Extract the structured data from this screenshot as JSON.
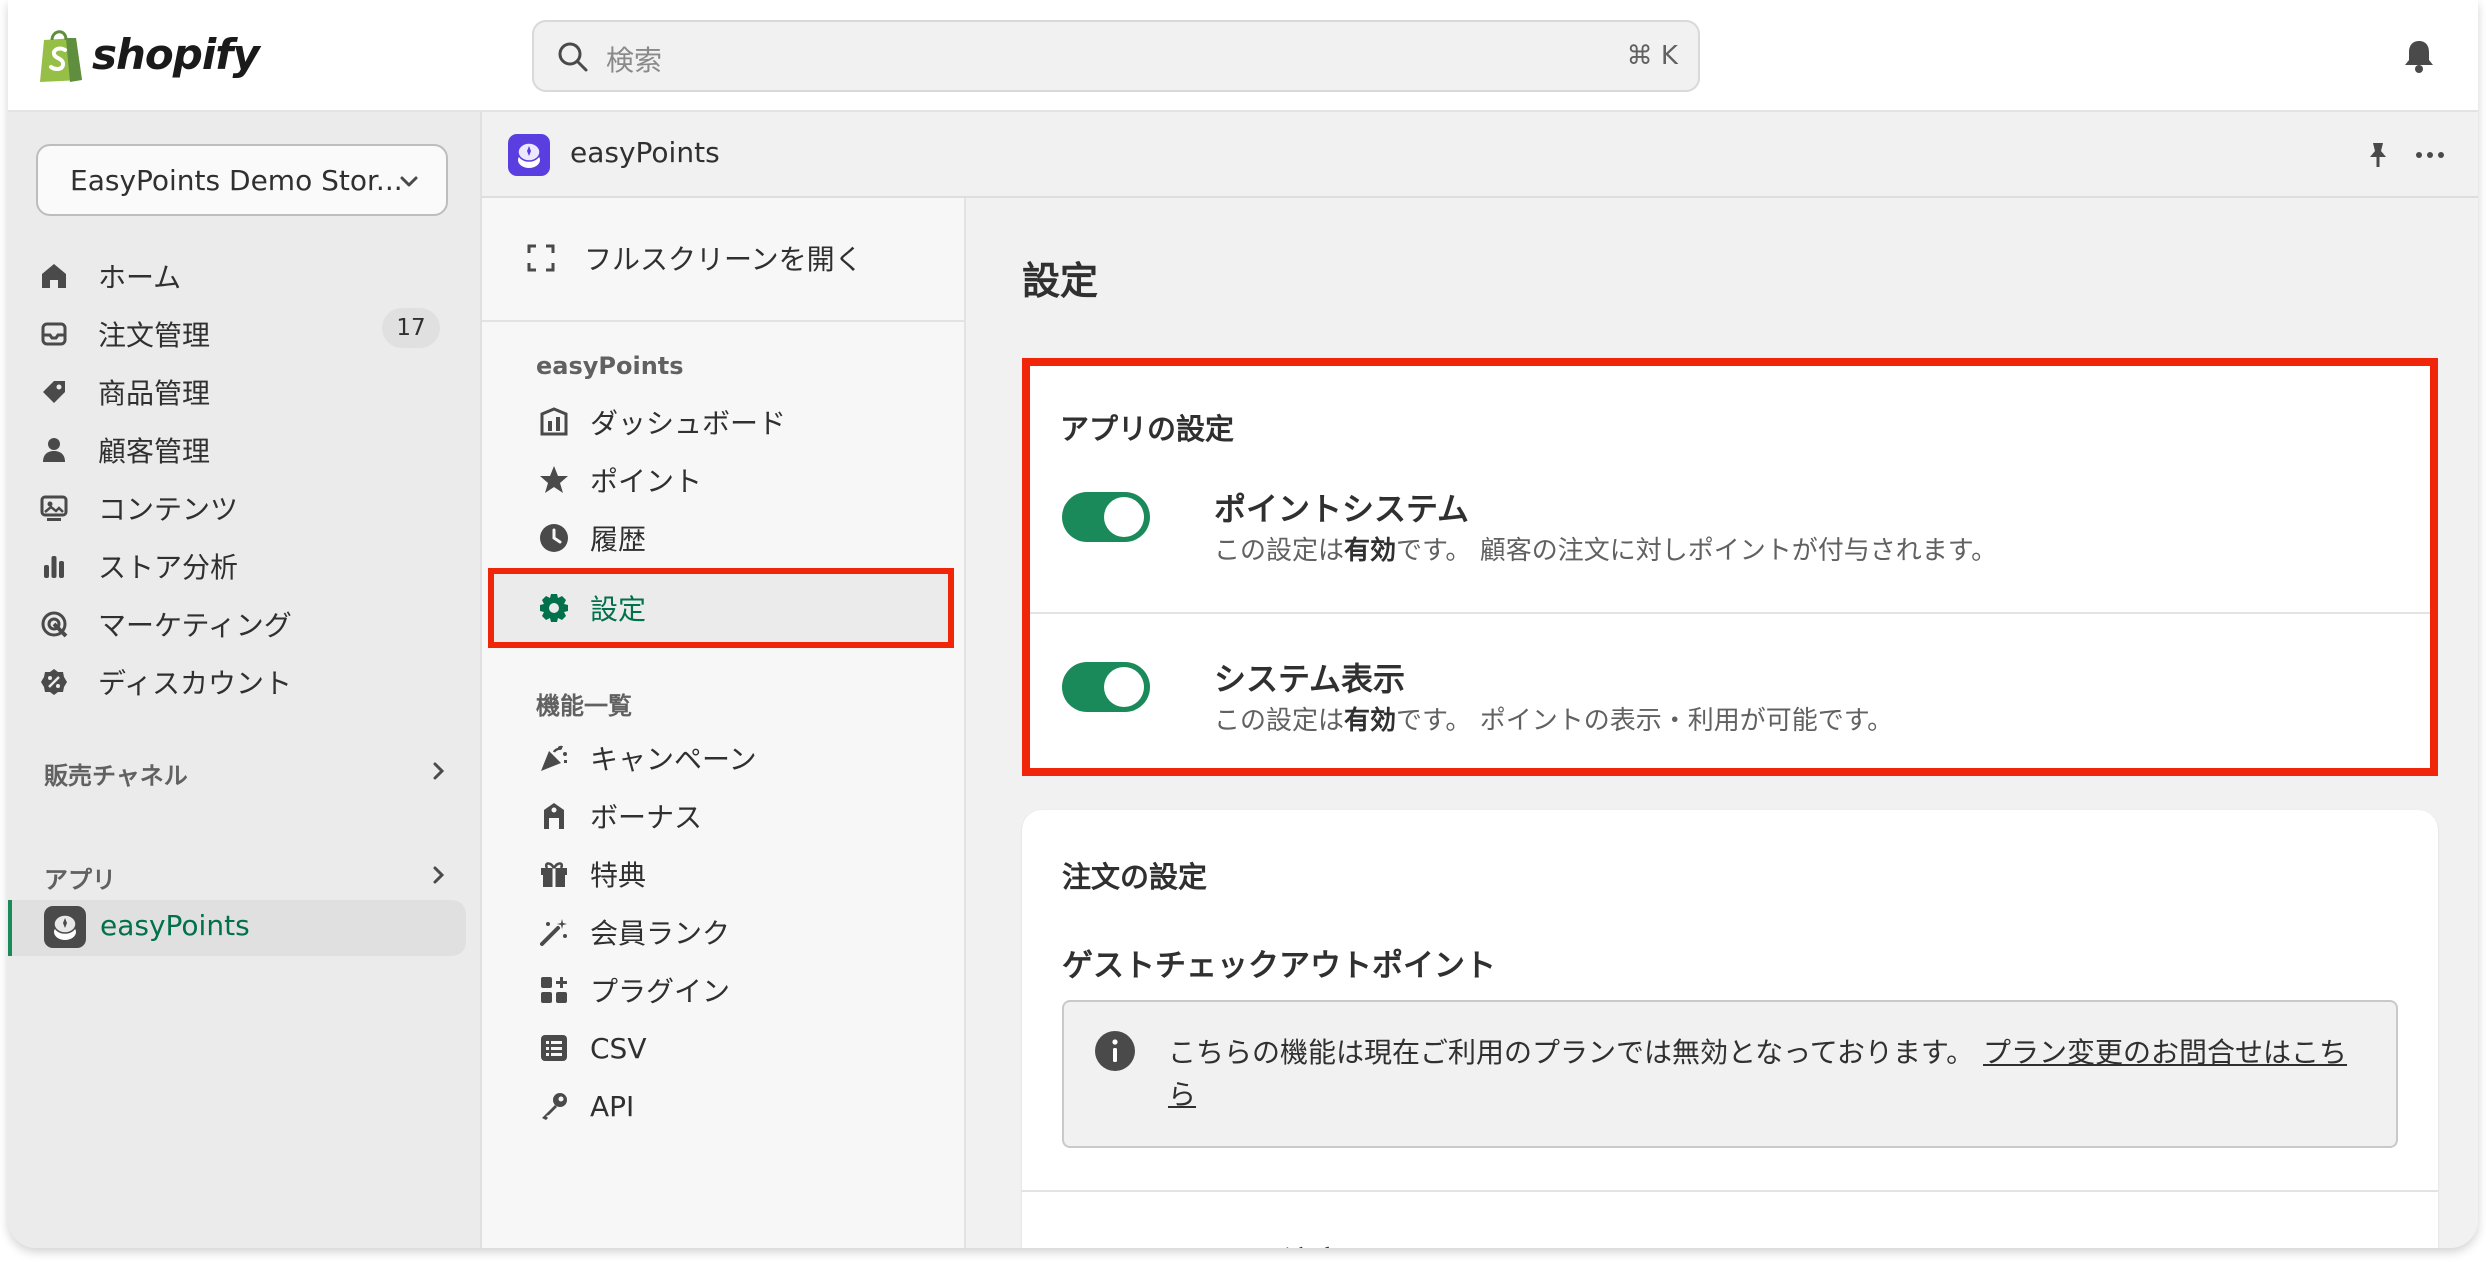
{
  "topbar": {
    "logo_text": "shopify",
    "search_placeholder": "検索",
    "search_shortcut": "⌘ K",
    "icons": [
      "search-icon",
      "bell-icon"
    ]
  },
  "sidebar": {
    "store_name": "EasyPoints Demo Stor...",
    "items": [
      {
        "label": "ホーム",
        "icon": "home-icon"
      },
      {
        "label": "注文管理",
        "icon": "inbox-icon",
        "badge": "17"
      },
      {
        "label": "商品管理",
        "icon": "tag-icon"
      },
      {
        "label": "顧客管理",
        "icon": "person-icon"
      },
      {
        "label": "コンテンツ",
        "icon": "content-icon"
      },
      {
        "label": "ストア分析",
        "icon": "bar-chart-icon"
      },
      {
        "label": "マーケティング",
        "icon": "target-icon"
      },
      {
        "label": "ディスカウント",
        "icon": "discount-icon"
      }
    ],
    "sales_channels_label": "販売チャネル",
    "apps_label": "アプリ",
    "active_app": "easyPoints"
  },
  "app_header": {
    "title": "easyPoints"
  },
  "app_nav": {
    "fullscreen_label": "フルスクリーンを開く",
    "group1_label": "easyPoints",
    "group1_items": [
      {
        "label": "ダッシュボード",
        "icon": "dashboard-icon"
      },
      {
        "label": "ポイント",
        "icon": "star-icon"
      },
      {
        "label": "履歴",
        "icon": "clock-icon"
      }
    ],
    "active_item": {
      "label": "設定",
      "icon": "gear-icon"
    },
    "group2_label": "機能一覧",
    "group2_items": [
      {
        "label": "キャンペーン",
        "icon": "party-icon"
      },
      {
        "label": "ボーナス",
        "icon": "bonus-tag-icon"
      },
      {
        "label": "特典",
        "icon": "gift-icon"
      },
      {
        "label": "会員ランク",
        "icon": "magic-wand-icon"
      },
      {
        "label": "プラグイン",
        "icon": "apps-icon"
      },
      {
        "label": "CSV",
        "icon": "list-icon"
      },
      {
        "label": "API",
        "icon": "key-icon"
      }
    ]
  },
  "main": {
    "page_title": "設定",
    "app_settings": {
      "title": "アプリの設定",
      "settings": [
        {
          "title": "ポイントシステム",
          "desc_prefix": "この設定は",
          "desc_status": "有効",
          "desc_suffix": "です。 顧客の注文に対しポイントが付与されます。",
          "enabled": true
        },
        {
          "title": "システム表示",
          "desc_prefix": "この設定は",
          "desc_status": "有効",
          "desc_suffix": "です。 ポイントの表示・利用が可能です。",
          "enabled": true
        }
      ]
    },
    "order_settings": {
      "title": "注文の設定",
      "subtitle": "ゲストチェックアウトポイント",
      "banner_text": "こちらの機能は現在ご利用のプランでは無効となっております。 ",
      "banner_link": "プラン変更のお問合せはこちら",
      "next_section_clipped": "POS注文"
    }
  },
  "colors": {
    "accent_green": "#1a8a5a",
    "active_text_green": "#00714a",
    "highlight_red": "#f0250a",
    "shopify_green": "#95bf47"
  }
}
